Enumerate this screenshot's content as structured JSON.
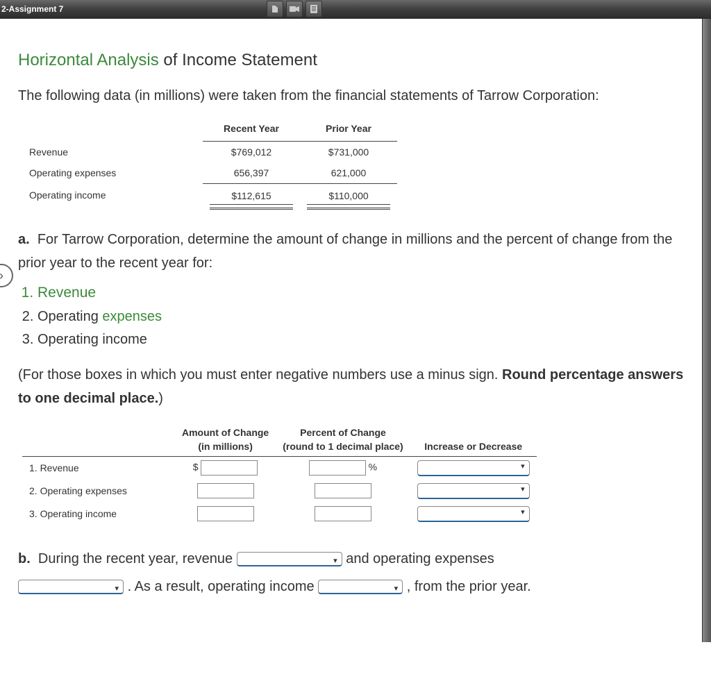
{
  "topbar": {
    "tab_title": "2-Assignment 7"
  },
  "heading": {
    "green": "Horizontal Analysis",
    "rest": " of Income Statement"
  },
  "intro": "The following data (in millions) were taken from the financial statements of Tarrow Corporation:",
  "table": {
    "col1": "Recent Year",
    "col2": "Prior Year",
    "rows": [
      {
        "label": "Revenue",
        "recent": "$769,012",
        "prior": "$731,000"
      },
      {
        "label": "Operating expenses",
        "recent": "656,397",
        "prior": "621,000"
      },
      {
        "label": "Operating income",
        "recent": "$112,615",
        "prior": "$110,000"
      }
    ]
  },
  "partA": {
    "letter": "a.",
    "text": "For Tarrow Corporation, determine the amount of change in millions and the percent of change from the prior year to the recent year for:",
    "items": [
      "Revenue",
      {
        "pre": "Operating ",
        "green": "expenses"
      },
      "Operating income"
    ],
    "note_open": "(For those boxes in which you must enter negative numbers use a minus sign. ",
    "note_bold": "Round percentage answers to one decimal place.",
    "note_close": ")"
  },
  "answerTable": {
    "header1a": "Amount of Change",
    "header1b": "(in millions)",
    "header2a": "Percent of Change",
    "header2b": "(round to 1 decimal place)",
    "header3": "Increase or Decrease",
    "rows": [
      "1. Revenue",
      "2. Operating expenses",
      "3. Operating income"
    ],
    "currency": "$",
    "percent": "%"
  },
  "partB": {
    "letter": "b.",
    "seg1": "During the recent year, revenue",
    "seg2": "and operating expenses",
    "seg3": ". As a result, operating income",
    "seg4": ", from the prior year."
  }
}
